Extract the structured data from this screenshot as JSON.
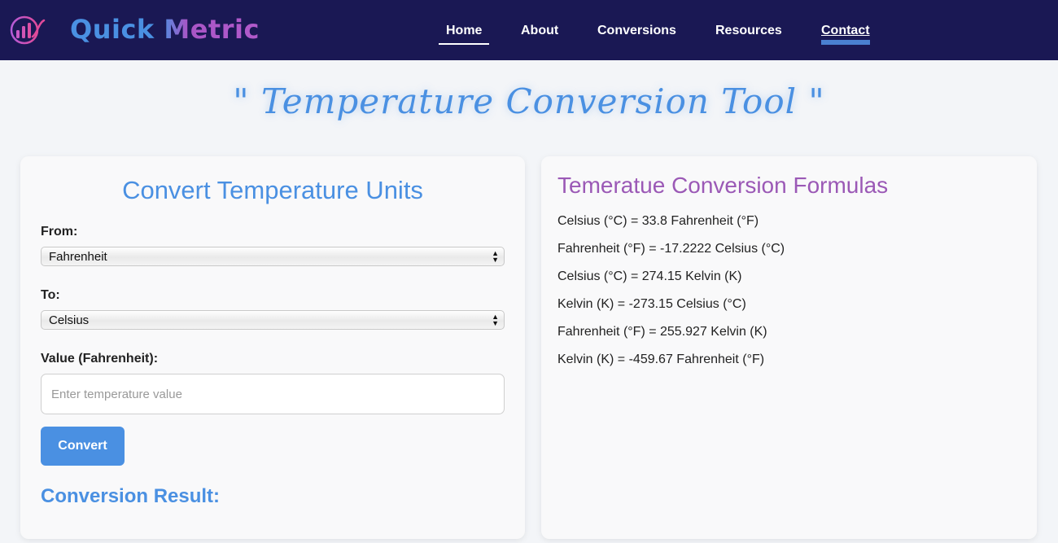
{
  "header": {
    "brand": "Quick Metric",
    "logo_icon": "chart-logo-icon",
    "nav": {
      "home": "Home",
      "about": "About",
      "conversions": "Conversions",
      "resources": "Resources",
      "contact": "Contact"
    },
    "colors": {
      "background": "#1a1854",
      "brand_blue": "#4a90e2",
      "brand_purple": "#a855c6"
    }
  },
  "page_title": "\" Temperature Conversion Tool \"",
  "converter": {
    "title": "Convert Temperature Units",
    "from_label": "From:",
    "from_value": "Fahrenheit",
    "to_label": "To:",
    "to_value": "Celsius",
    "value_label": "Value (Fahrenheit):",
    "value_placeholder": "Enter temperature value",
    "button_label": "Convert",
    "result_title": "Conversion Result:"
  },
  "formulas": {
    "title": "Temeratue Conversion Formulas",
    "items": [
      "Celsius (°C) = 33.8 Fahrenheit (°F)",
      "Fahrenheit (°F) = -17.2222 Celsius (°C)",
      "Celsius (°C) = 274.15 Kelvin (K)",
      "Kelvin (K) = -273.15 Celsius (°C)",
      "Fahrenheit (°F) = 255.927 Kelvin (K)",
      "Kelvin (K) = -459.67 Fahrenheit (°F)"
    ]
  },
  "colors": {
    "accent": "#4a90e2",
    "formula_title": "#9b59b6"
  }
}
